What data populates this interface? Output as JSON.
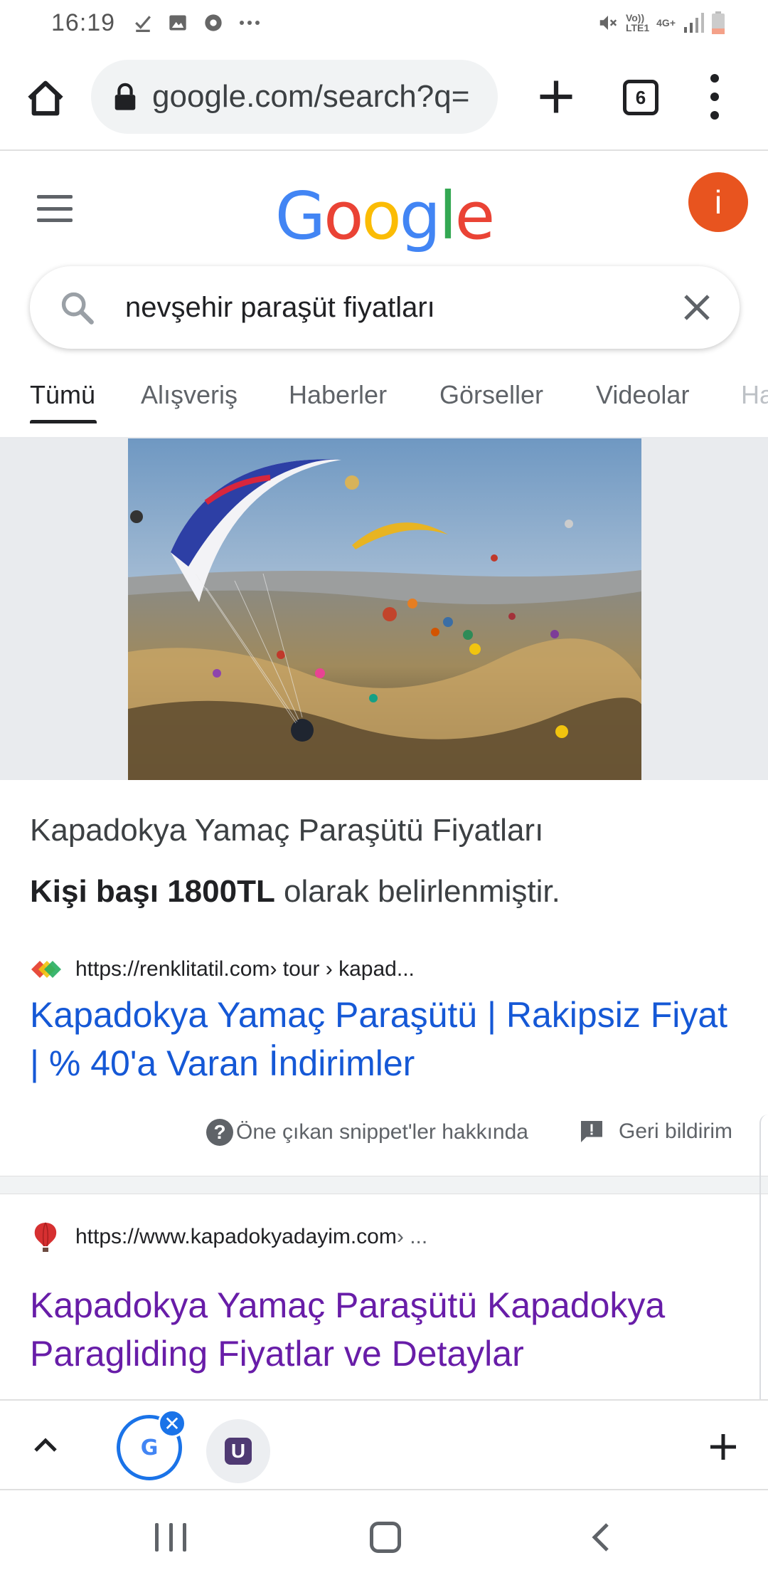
{
  "status_bar": {
    "time": "16:19",
    "network_label_top": "Vo))",
    "network_label_bottom": "LTE1",
    "network_type": "4G+"
  },
  "browser": {
    "url": "google.com/search?q=",
    "tab_count": "6"
  },
  "google": {
    "logo": "Google",
    "avatar_letter": "i",
    "search_query": "nevşehir paraşüt fiyatları",
    "tabs": [
      "Tümü",
      "Alışveriş",
      "Haberler",
      "Görseller",
      "Videolar",
      "Ha"
    ],
    "active_tab": "Tümü"
  },
  "featured_snippet": {
    "heading": "Kapadokya Yamaç Paraşütü Fiyatları",
    "answer_bold": "Kişi başı 1800TL",
    "answer_rest": " olarak belirlenmiştir.",
    "source_url": "https://renklitatil.com",
    "source_path": " › tour › kapad...",
    "title": "Kapadokya Yamaç Paraşütü | Rakipsiz Fiyat | % 40'a Varan İndirimler",
    "about_label": "Öne çıkan snippet'ler hakkında",
    "feedback_label": "Geri bildirim"
  },
  "results": [
    {
      "url": "https://www.kapadokyadayim.com",
      "path": " › ...",
      "title": "Kapadokya Yamaç Paraşütü Kapadokya Paragliding Fiyatlar ve Detaylar"
    }
  ],
  "tab_strip": {
    "google_chip": "G",
    "u_chip": "U"
  },
  "colors": {
    "link_blue": "#1558d6",
    "visited_purple": "#681da8",
    "avatar": "#e8541f",
    "active_tab_ring": "#1a73e8"
  }
}
